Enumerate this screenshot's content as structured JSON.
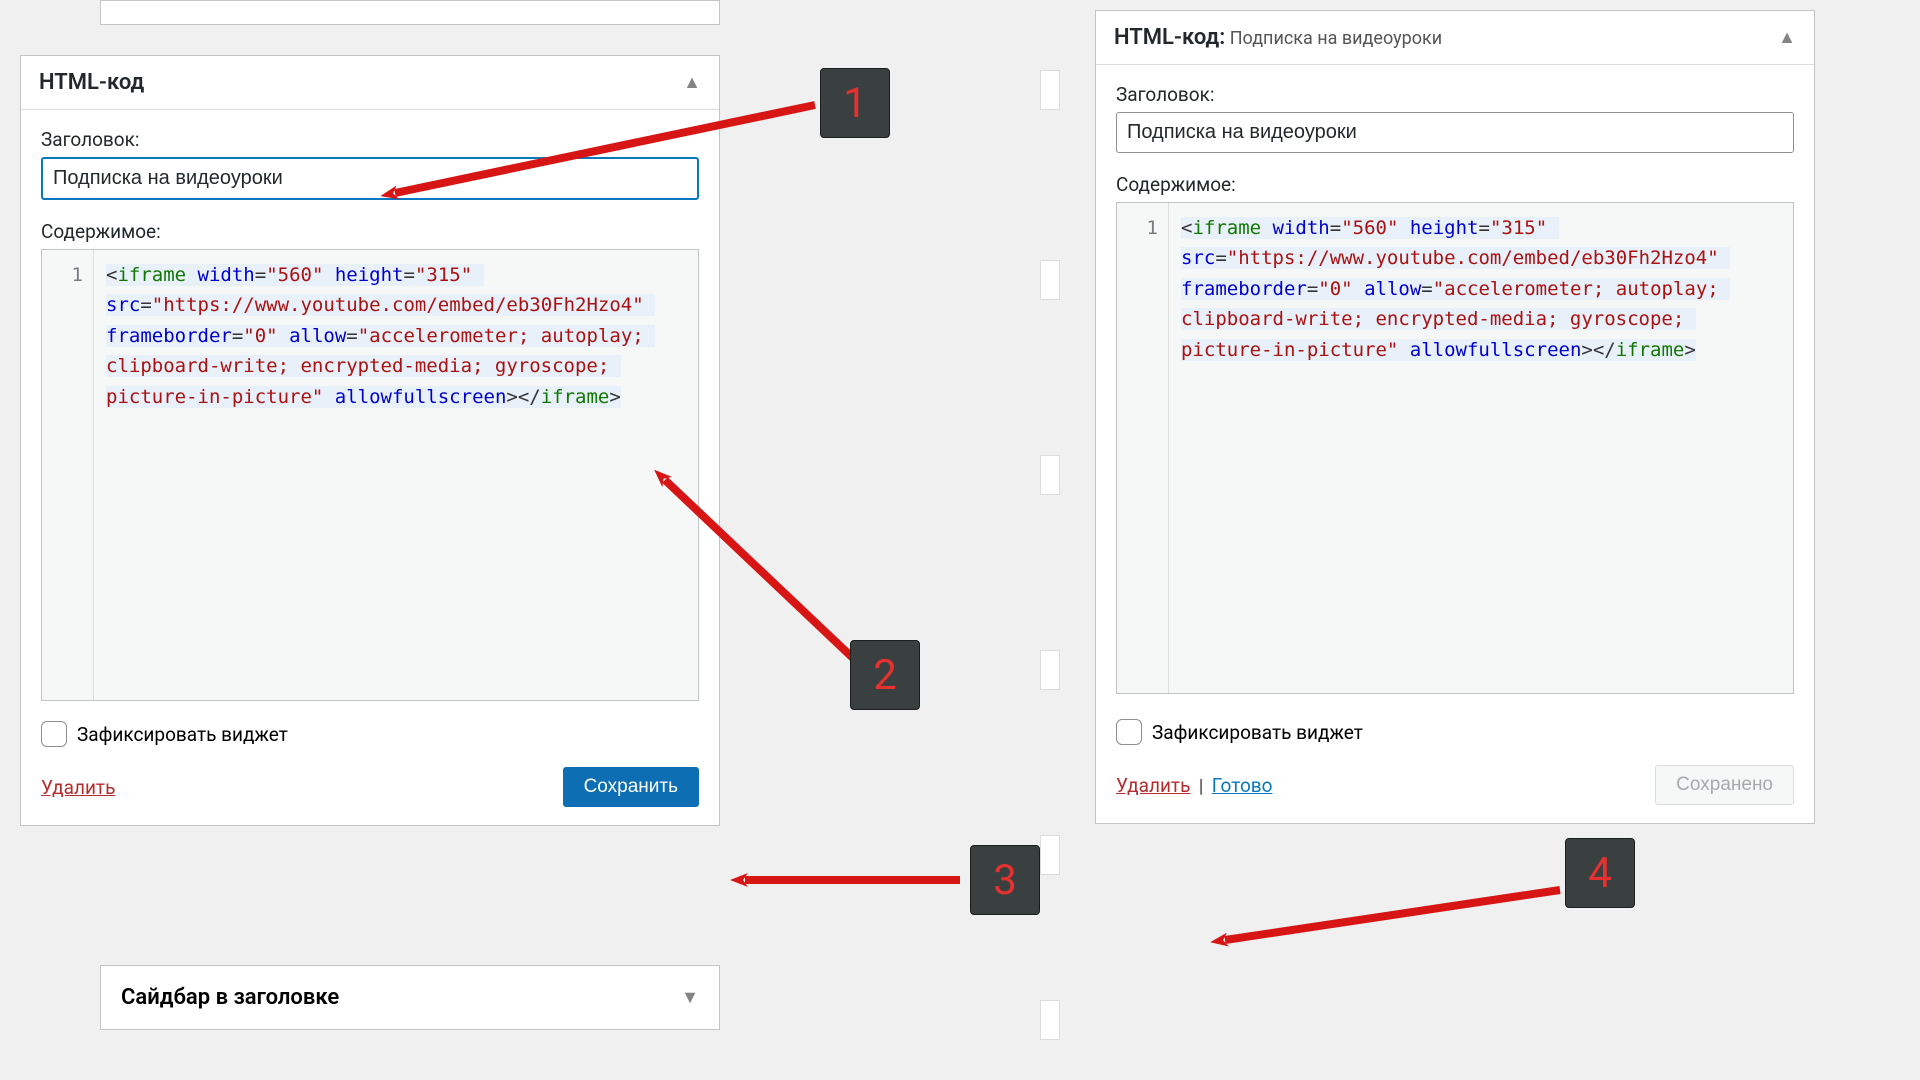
{
  "left": {
    "header_title": "HTML-код",
    "label_title": "Заголовок:",
    "title_value": "Подписка на видеоуроки",
    "label_content": "Содержимое:",
    "gutter_line": "1",
    "code_tokens": [
      {
        "c": "t-punc",
        "t": "<"
      },
      {
        "c": "t-tag",
        "t": "iframe"
      },
      {
        "c": "",
        "t": " "
      },
      {
        "c": "t-attr",
        "t": "width"
      },
      {
        "c": "t-punc",
        "t": "="
      },
      {
        "c": "t-str",
        "t": "\"560\""
      },
      {
        "c": "",
        "t": " "
      },
      {
        "c": "t-attr",
        "t": "height"
      },
      {
        "c": "t-punc",
        "t": "="
      },
      {
        "c": "t-str",
        "t": "\"315\""
      },
      {
        "c": "",
        "t": " "
      },
      {
        "c": "t-attr",
        "t": "src"
      },
      {
        "c": "t-punc",
        "t": "="
      },
      {
        "c": "t-str",
        "t": "\"https://www.youtube.com/embed/eb30Fh2Hzo4\""
      },
      {
        "c": "",
        "t": " "
      },
      {
        "c": "t-attr",
        "t": "frameborder"
      },
      {
        "c": "t-punc",
        "t": "="
      },
      {
        "c": "t-str",
        "t": "\"0\""
      },
      {
        "c": "",
        "t": " "
      },
      {
        "c": "t-attr",
        "t": "allow"
      },
      {
        "c": "t-punc",
        "t": "="
      },
      {
        "c": "t-str",
        "t": "\"accelerometer; autoplay; clipboard-write; encrypted-media; gyroscope; picture-in-picture\""
      },
      {
        "c": "",
        "t": " "
      },
      {
        "c": "t-attr",
        "t": "allowfullscreen"
      },
      {
        "c": "t-punc",
        "t": ">"
      },
      {
        "c": "t-punc",
        "t": "</"
      },
      {
        "c": "t-tag",
        "t": "iframe"
      },
      {
        "c": "t-punc",
        "t": ">"
      }
    ],
    "checkbox_label": "Зафиксировать виджет",
    "delete_label": "Удалить",
    "save_label": "Сохранить"
  },
  "right": {
    "header_prefix": "HTML-код:",
    "header_suffix": "Подписка на видеоуроки",
    "label_title": "Заголовок:",
    "title_value": "Подписка на видеоуроки",
    "label_content": "Содержимое:",
    "gutter_line": "1",
    "code_tokens": [
      {
        "c": "t-punc",
        "t": "<"
      },
      {
        "c": "t-tag",
        "t": "iframe"
      },
      {
        "c": "",
        "t": " "
      },
      {
        "c": "t-attr",
        "t": "width"
      },
      {
        "c": "t-punc",
        "t": "="
      },
      {
        "c": "t-str",
        "t": "\"560\""
      },
      {
        "c": "",
        "t": " "
      },
      {
        "c": "t-attr",
        "t": "height"
      },
      {
        "c": "t-punc",
        "t": "="
      },
      {
        "c": "t-str",
        "t": "\"315\""
      },
      {
        "c": "",
        "t": " "
      },
      {
        "c": "t-attr",
        "t": "src"
      },
      {
        "c": "t-punc",
        "t": "="
      },
      {
        "c": "t-str",
        "t": "\"https://www.youtube.com/embed/eb30Fh2Hzo4\""
      },
      {
        "c": "",
        "t": " "
      },
      {
        "c": "t-attr",
        "t": "frameborder"
      },
      {
        "c": "t-punc",
        "t": "="
      },
      {
        "c": "t-str",
        "t": "\"0\""
      },
      {
        "c": "",
        "t": " "
      },
      {
        "c": "t-attr",
        "t": "allow"
      },
      {
        "c": "t-punc",
        "t": "="
      },
      {
        "c": "t-str",
        "t": "\"accelerometer; autoplay; clipboard-write; encrypted-media; gyroscope; picture-in-picture\""
      },
      {
        "c": "",
        "t": " "
      },
      {
        "c": "t-attr",
        "t": "allowfullscreen"
      },
      {
        "c": "t-punc",
        "t": ">"
      },
      {
        "c": "t-punc",
        "t": "</"
      },
      {
        "c": "t-tag",
        "t": "iframe"
      },
      {
        "c": "t-punc",
        "t": ">"
      }
    ],
    "checkbox_label": "Зафиксировать виджет",
    "delete_label": "Удалить",
    "done_label": "Готово",
    "saved_label": "Сохранено"
  },
  "bottom_panel_title": "Сайдбар в заголовке",
  "markers": {
    "m1": "1",
    "m2": "2",
    "m3": "3",
    "m4": "4"
  }
}
